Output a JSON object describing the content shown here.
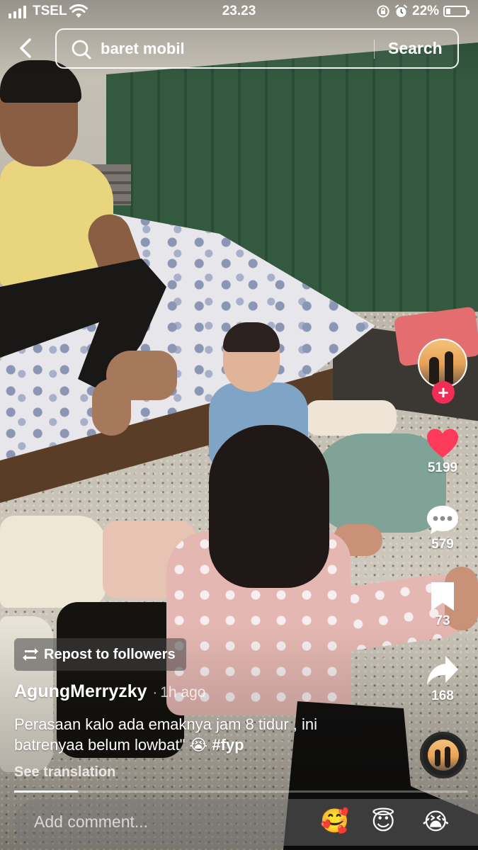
{
  "status_bar": {
    "carrier": "TSEL",
    "time": "23.23",
    "battery": "22%",
    "battery_level": 0.22
  },
  "search": {
    "query": "baret mobil",
    "button_label": "Search"
  },
  "side_rail": {
    "likes": "5199",
    "comments": "579",
    "saves": "73",
    "shares": "168",
    "like_color": "#ff3b5c",
    "follow_color": "#f02e55"
  },
  "post": {
    "repost_label": "Repost to followers",
    "author": "AgungMerryzky",
    "separator": "·",
    "time_ago": "1h ago",
    "caption_line1": "Perasaan kalo ada emaknya jam 8 tidur , ini",
    "caption_line2": "batrenyaa belum lowbat\"",
    "caption_emoji": "😭",
    "hashtag": "#fyp",
    "see_translation": "See translation",
    "progress": 0.14
  },
  "comment_bar": {
    "placeholder": "Add comment...",
    "emojis": [
      "🥰",
      "😇",
      "😭"
    ]
  },
  "icons": {
    "back": "chevron-left-icon",
    "search": "search-icon",
    "like": "heart-icon",
    "comment": "comment-bubble-icon",
    "save": "bookmark-icon",
    "share": "share-arrow-icon",
    "repost": "repost-icon"
  }
}
